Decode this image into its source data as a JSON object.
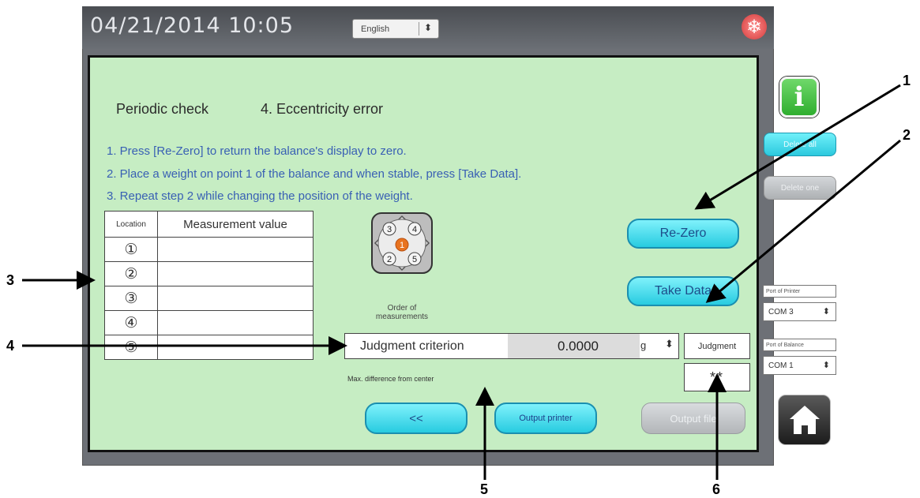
{
  "header": {
    "datetime": "04/21/2014 10:05",
    "language": "English"
  },
  "panel": {
    "title_left": "Periodic check",
    "title_right": "4. Eccentricity error",
    "instructions": [
      "1. Press [Re-Zero] to return the balance's display to zero.",
      "2. Place a weight on point 1 of the balance and when stable, press [Take Data].",
      "3. Repeat step 2 while changing the position of the weight."
    ]
  },
  "table": {
    "header_location": "Location",
    "header_value": "Measurement value",
    "rows": [
      {
        "location": "①",
        "value": ""
      },
      {
        "location": "②",
        "value": ""
      },
      {
        "location": "③",
        "value": ""
      },
      {
        "location": "④",
        "value": ""
      },
      {
        "location": "⑤",
        "value": ""
      }
    ]
  },
  "diagram": {
    "points": [
      "1",
      "2",
      "3",
      "4",
      "5"
    ],
    "caption_line1": "Order of",
    "caption_line2": "measurements"
  },
  "buttons": {
    "rezero": "Re-Zero",
    "take_data": "Take Data",
    "back": "<<",
    "output_printer": "Output printer",
    "output_file": "Output file"
  },
  "criterion": {
    "label": "Judgment criterion",
    "value": "0.0000",
    "unit": "g",
    "note": "Max. difference from center"
  },
  "judgment": {
    "header": "Judgment",
    "value": "**"
  },
  "sidebar": {
    "delete_all": "Delete all",
    "delete_one": "Delete one",
    "printer_port_label": "Port of Printer",
    "printer_port": "COM 3",
    "balance_port_label": "Port of Balance",
    "balance_port": "COM 1"
  },
  "callouts": [
    "1",
    "2",
    "3",
    "4",
    "5",
    "6"
  ],
  "colors": {
    "panel_bg": "#c6edc3",
    "button_cyan": "#27cbe0",
    "instruction_text": "#3960b4",
    "info_green": "#2fae2f"
  },
  "icons": [
    "snowflake-icon",
    "info-icon",
    "home-icon"
  ]
}
